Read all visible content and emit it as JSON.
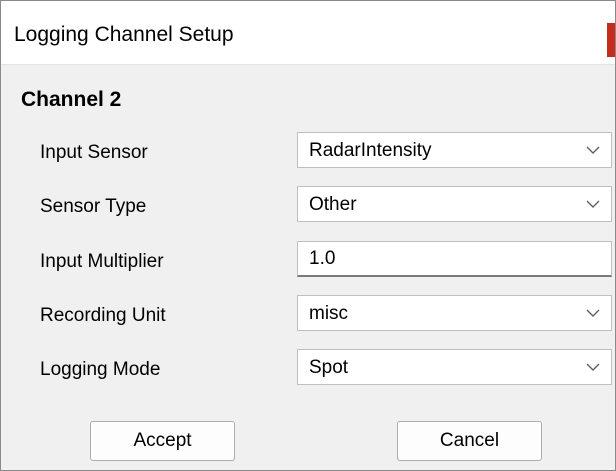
{
  "window": {
    "title": "Logging Channel Setup",
    "close_accent_color": "#c42b1c"
  },
  "form": {
    "heading": "Channel 2",
    "fields": [
      {
        "label": "Input Sensor",
        "type": "select",
        "value": "RadarIntensity"
      },
      {
        "label": "Sensor Type",
        "type": "select",
        "value": "Other"
      },
      {
        "label": "Input Multiplier",
        "type": "text",
        "value": "1.0"
      },
      {
        "label": "Recording Unit",
        "type": "select",
        "value": "misc"
      },
      {
        "label": "Logging Mode",
        "type": "select",
        "value": "Spot"
      }
    ]
  },
  "buttons": {
    "accept_label": "Accept",
    "cancel_label": "Cancel"
  },
  "icons": {
    "dropdown": "chevron-down-icon"
  }
}
